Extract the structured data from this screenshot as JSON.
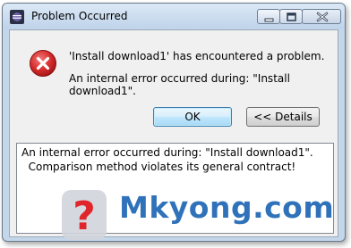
{
  "window": {
    "title": "Problem Occurred"
  },
  "icons": {
    "app": "eclipse-icon",
    "message": "error-icon",
    "minimize": "minimize-icon",
    "maximize": "maximize-icon",
    "close": "close-icon"
  },
  "message": {
    "title": "'Install download1' has encountered a problem.",
    "detail": "An internal error occurred during: \"Install download1\"."
  },
  "buttons": {
    "ok_label": "OK",
    "details_label": "<< Details"
  },
  "details": {
    "text": "An internal error occurred during: \"Install download1\".\n  Comparison method violates its general contract!"
  },
  "watermark": {
    "text": "Mkyong.com"
  },
  "colors": {
    "error_red": "#d42a2a",
    "watermark_blue": "#1f67b5",
    "dialog_bg": "#f0f0f0"
  }
}
